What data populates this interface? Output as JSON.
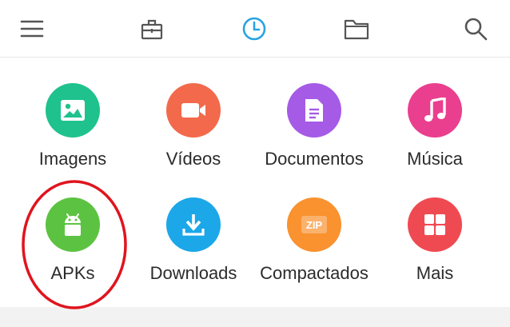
{
  "toolbar": {
    "icons": [
      "menu-icon",
      "toolbox-icon",
      "recent-clock-icon",
      "folder-icon",
      "search-icon"
    ],
    "active": "recent-clock-icon",
    "active_color": "#29a3e3",
    "icon_color": "#555555"
  },
  "categories": [
    {
      "label": "Imagens",
      "icon": "image-icon",
      "color": "#1fc28d"
    },
    {
      "label": "Vídeos",
      "icon": "video-camera-icon",
      "color": "#f26a4b"
    },
    {
      "label": "Documentos",
      "icon": "document-icon",
      "color": "#a55be6"
    },
    {
      "label": "Música",
      "icon": "music-note-icon",
      "color": "#ea3f8e"
    },
    {
      "label": "APKs",
      "icon": "android-icon",
      "color": "#5cc342"
    },
    {
      "label": "Downloads",
      "icon": "download-icon",
      "color": "#1ba7e8"
    },
    {
      "label": "Compactados",
      "icon": "zip-icon",
      "color": "#f9922f"
    },
    {
      "label": "Mais",
      "icon": "grid-more-icon",
      "color": "#ef4a52"
    }
  ],
  "annotation": {
    "shape": "ellipse",
    "color": "#e0141e",
    "target": "APKs"
  }
}
